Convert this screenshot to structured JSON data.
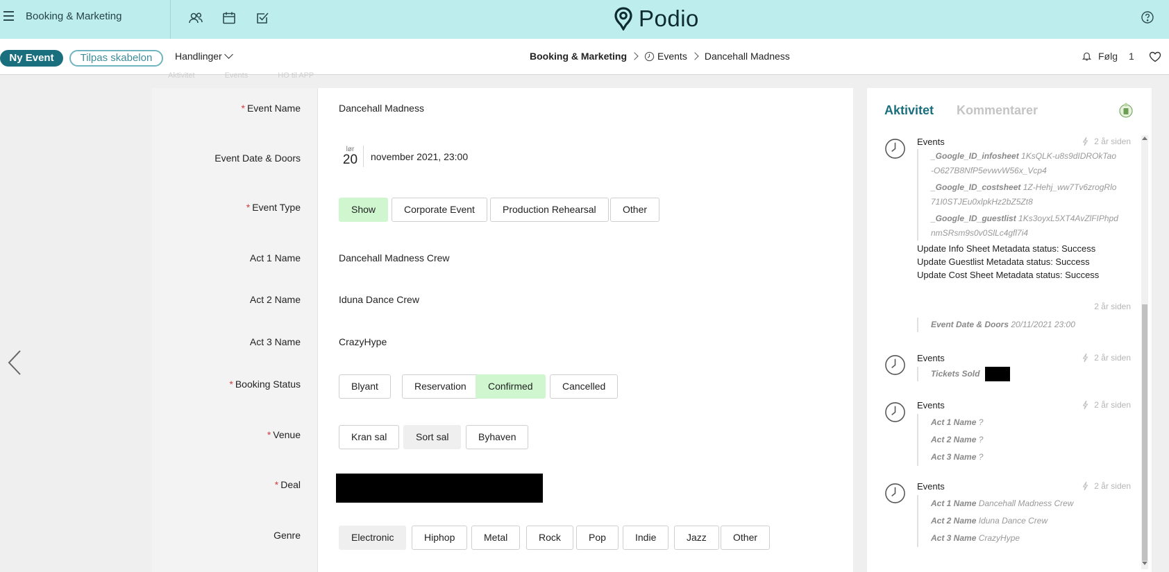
{
  "topbar": {
    "workspace_title": "Booking & Marketing",
    "logo_text": "Podio",
    "icons": [
      "hamburger-icon",
      "contacts-icon",
      "calendar-icon",
      "tasks-icon",
      "help-icon"
    ]
  },
  "actionbar": {
    "new_button": "Ny Event",
    "customize_button": "Tilpas skabelon",
    "actions_menu": "Handlinger",
    "breadcrumb": {
      "workspace": "Booking & Marketing",
      "app": "Events",
      "item": "Dancehall Madness"
    },
    "follow_label": "Følg",
    "follow_count": "1",
    "ghost_tabs": [
      "Aktivitet",
      "Events",
      "HO til APP"
    ]
  },
  "form": {
    "event_name": {
      "label": "Event Name",
      "value": "Dancehall Madness",
      "required": true
    },
    "event_date": {
      "label": "Event Date & Doors",
      "weekday": "lør",
      "day": "20",
      "text": "november 2021, 23:00"
    },
    "event_type": {
      "label": "Event Type",
      "options": [
        "Show",
        "Corporate Event",
        "Production Rehearsal",
        "Other"
      ],
      "selected": "Show"
    },
    "act1": {
      "label": "Act 1 Name",
      "value": "Dancehall Madness Crew"
    },
    "act2": {
      "label": "Act 2 Name",
      "value": "Iduna Dance Crew"
    },
    "act3": {
      "label": "Act 3 Name",
      "value": "CrazyHype"
    },
    "booking_status": {
      "label": "Booking Status",
      "options": [
        "Blyant",
        "Reservation",
        "Confirmed",
        "Cancelled"
      ],
      "selected": "Confirmed"
    },
    "venue": {
      "label": "Venue",
      "options": [
        "Kran sal",
        "Sort sal",
        "Byhaven"
      ],
      "hovered": "Sort sal"
    },
    "deal": {
      "label": "Deal"
    },
    "genre": {
      "label": "Genre",
      "options": [
        "Electronic",
        "Hiphop",
        "Metal",
        "Rock",
        "Pop",
        "Indie",
        "Jazz",
        "Other"
      ],
      "hovered": "Electronic"
    }
  },
  "activity": {
    "tab_active": "Aktivitet",
    "tab_inactive": "Kommentarer",
    "items": [
      {
        "title": "Events",
        "time": "2 år siden",
        "details": [
          {
            "key": "_Google_ID_infosheet",
            "value": "1KsQLK-u8s9dIDROkTao-O627B8NfP5evwvW56x_Vcp4"
          },
          {
            "key": "_Google_ID_costsheet",
            "value": "1Z-Hehj_ww7Tv6zrogRlo71I0STJEu0xlpkHz2bZ5Zt8"
          },
          {
            "key": "_Google_ID_guestlist",
            "value": "1Ks3oyxL5XT4AvZlFIPhpdnmSRsm9s0v0SlLc4gfl7i4"
          }
        ],
        "messages": [
          "Update Info Sheet Metadata status: Success",
          "Update Guestlist Metadata status: Success",
          "Update Cost Sheet Metadata status: Success"
        ]
      },
      {
        "time": "2 år siden",
        "details": [
          {
            "key": "Event Date & Doors",
            "value": "20/11/2021 23:00"
          }
        ]
      },
      {
        "title": "Events",
        "time": "2 år siden",
        "details": [
          {
            "key": "Tickets Sold",
            "value": ""
          }
        ]
      },
      {
        "title": "Events",
        "time": "2 år siden",
        "details": [
          {
            "key": "Act 1 Name",
            "value": "?"
          },
          {
            "key": "Act 2 Name",
            "value": "?"
          },
          {
            "key": "Act 3 Name",
            "value": "?"
          }
        ]
      },
      {
        "title": "Events",
        "time": "2 år siden",
        "details": [
          {
            "key": "Act 1 Name",
            "value": "Dancehall Madness Crew"
          },
          {
            "key": "Act 2 Name",
            "value": "Iduna Dance Crew"
          },
          {
            "key": "Act 3 Name",
            "value": "CrazyHype"
          }
        ]
      }
    ]
  },
  "colors": {
    "topbar": "#bdeeed",
    "primary": "#1a6f7f",
    "selected_chip": "#cff6cf",
    "required": "#d23b3b"
  }
}
